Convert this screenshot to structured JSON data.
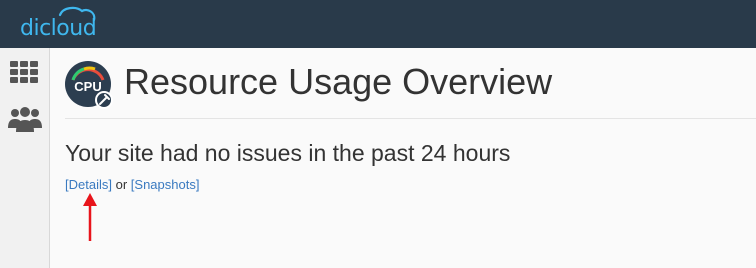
{
  "brand": {
    "name": "dicloud",
    "color": "#3fb7ee"
  },
  "sidebar": {
    "items": [
      {
        "name": "apps-grid",
        "icon": "grid-icon"
      },
      {
        "name": "users",
        "icon": "users-icon"
      }
    ]
  },
  "page": {
    "title": "Resource Usage Overview",
    "icon": "cpu-gauge-icon",
    "icon_label": "CPU"
  },
  "status": {
    "message": "Your site had no issues in the past 24 hours",
    "details_label": "[Details]",
    "or_text": "or",
    "snapshots_label": "[Snapshots]"
  },
  "colors": {
    "topbar": "#293a4a",
    "link": "#3a7ac0",
    "annotation_arrow": "#e8141b"
  }
}
